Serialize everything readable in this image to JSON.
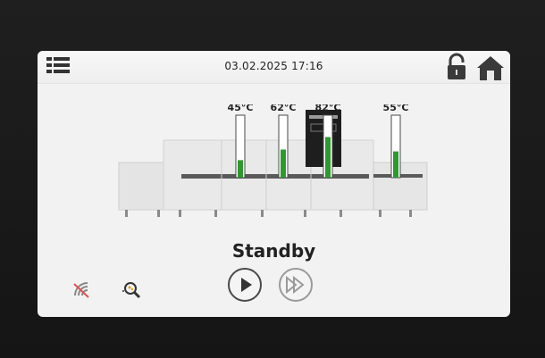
{
  "header": {
    "datetime": "03.02.2025 17:16"
  },
  "temperatures": [
    {
      "label": "45°C",
      "level": 0.28
    },
    {
      "label": "62°C",
      "level": 0.45
    },
    {
      "label": "82°C",
      "level": 0.65
    },
    {
      "label": "55°C",
      "level": 0.42
    }
  ],
  "status": {
    "text": "Standby"
  },
  "colors": {
    "fill": "#2e9a2e",
    "screen_bg": "#f2f2f2",
    "bezel": "#1a1a1a"
  },
  "icons": [
    "menu-icon",
    "lock-icon",
    "home-icon",
    "wifi-off-icon",
    "diagnostics-icon",
    "play-icon",
    "fast-forward-icon"
  ]
}
